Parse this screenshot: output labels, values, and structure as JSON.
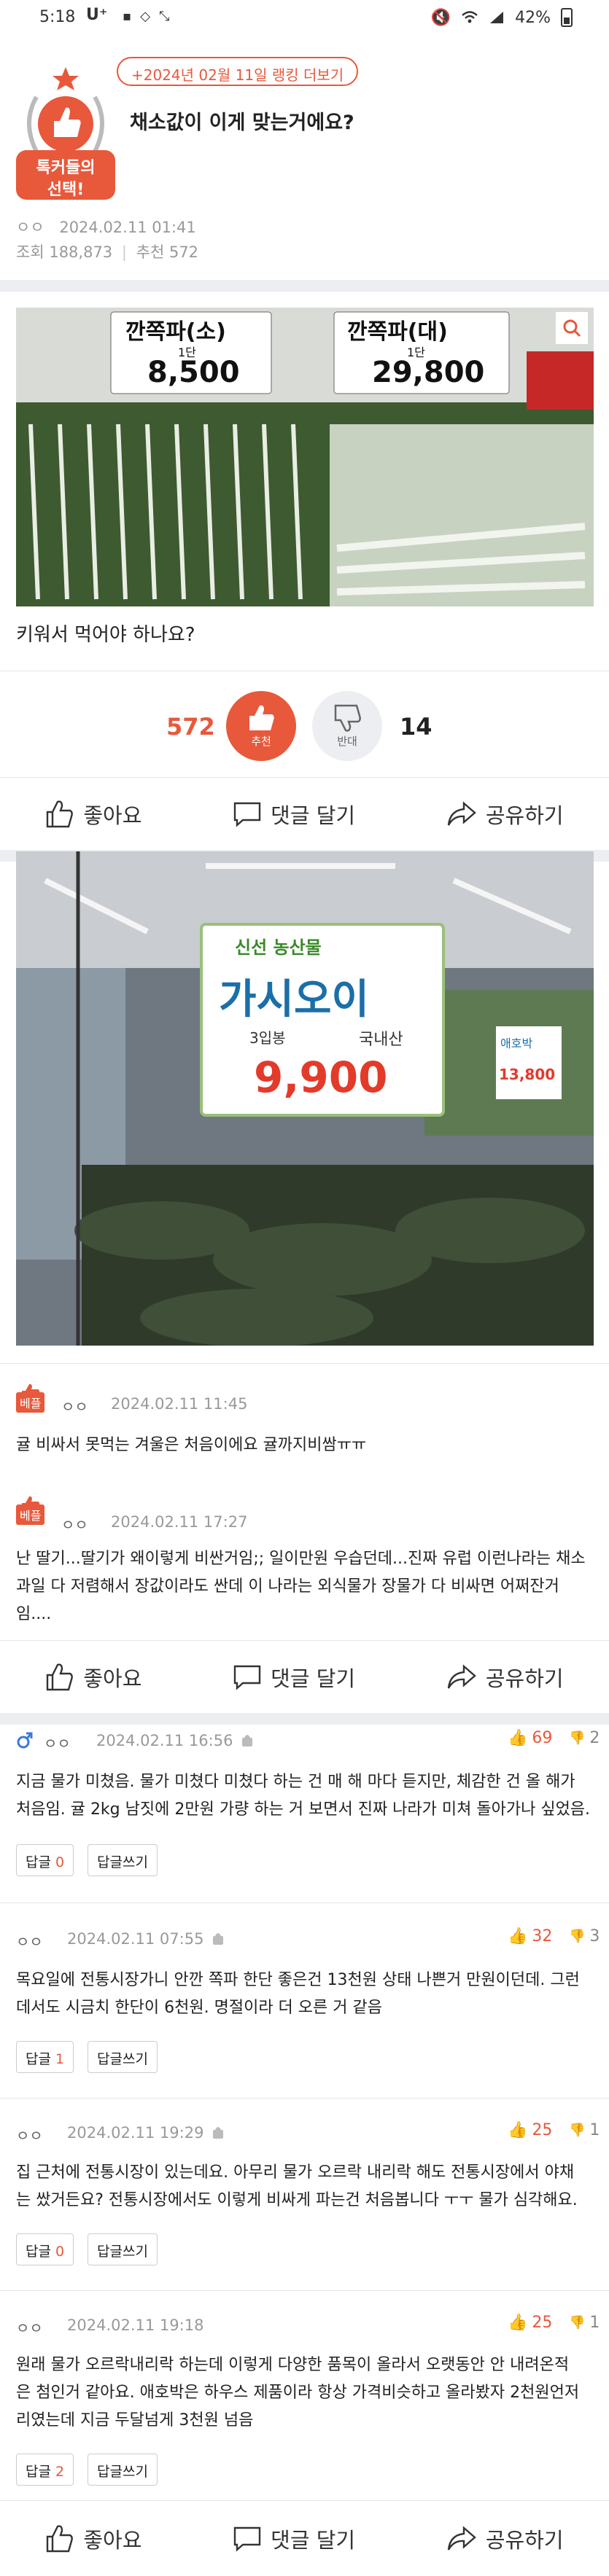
{
  "status_bar": {
    "time": "5:18",
    "carrier": "U⁺",
    "battery": "42%",
    "left_icons": [
      "talk-icon",
      "shield-icon",
      "expand-icon"
    ],
    "right_icons": [
      "mute-icon",
      "wifi-icon",
      "signal-icon"
    ]
  },
  "post": {
    "ranking_badge": "+2024년 02월 11일 랭킹 더보기",
    "mark_line1": "톡커들의",
    "mark_line2": "선택!",
    "title": "채소값이 이게 맞는거에요?",
    "author": "ㅇㅇ",
    "date": "2024.02.11 01:41",
    "views_label": "조회",
    "views": "188,873",
    "recommend_label": "추천",
    "recommend": "572",
    "photo1_labels": [
      "깐쪽파(소)",
      "1단",
      "8,500",
      "깐쪽파(대)",
      "1단",
      "29,800"
    ],
    "body": "키워서 먹어야 하나요?",
    "photo2_labels": [
      "신선 농산물",
      "가시오이",
      "3입봉",
      "국내산",
      "9,900",
      "애호박",
      "13,800"
    ]
  },
  "vote": {
    "up_count": "572",
    "up_label": "추천",
    "down_count": "14",
    "down_label": "반대"
  },
  "actions": {
    "like": "좋아요",
    "comment": "댓글 달기",
    "share": "공유하기"
  },
  "best_comments": [
    {
      "tag": "베플",
      "nick": "ㅇㅇ",
      "date": "2024.02.11 11:45",
      "text": "귤 비싸서 못먹는 겨울은 처음이에요 귤까지비쌈ㅠㅠ"
    },
    {
      "tag": "베플",
      "nick": "ㅇㅇ",
      "date": "2024.02.11 17:27",
      "text_line1": "난 딸기...딸기가 왜이렇게 비싼거임;; 일이만원 우습던데...진짜 유럽 이런나라는 채소",
      "text_line2": "과일 다 저렴해서 장값이라도 싼데 이 나라는 외식물가 장물가 다 비싸면 어쩌잔거",
      "text_line3": "임...."
    }
  ],
  "comments": [
    {
      "nick": "ㅇㅇ",
      "date": "2024.02.11 16:56",
      "likes": "69",
      "dislikes": "2",
      "line1": "지금 물가 미쳤음. 물가 미쳤다 미쳤다 하는 건 매 해 마다 듣지만, 체감한 건 올 해가",
      "line2": "처음임. 귤 2kg 남짓에 2만원 가량 하는 거 보면서 진짜 나라가 미쳐 돌아가나 싶었음.",
      "reply_label": "답글",
      "reply_count": "0",
      "write_label": "답글쓰기"
    },
    {
      "nick": "ㅇㅇ",
      "date": "2024.02.11 07:55",
      "likes": "32",
      "dislikes": "3",
      "line1": "목요일에 전통시장가니 안깐 쪽파 한단 좋은건 13천원 상태 나쁜거 만원이던데. 그런",
      "line2": "데서도 시금치 한단이 6천원. 명절이라 더 오른 거 같음",
      "reply_label": "답글",
      "reply_count": "1",
      "write_label": "답글쓰기"
    },
    {
      "nick": "ㅇㅇ",
      "date": "2024.02.11 19:29",
      "likes": "25",
      "dislikes": "1",
      "line1": "집 근처에 전통시장이 있는데요. 아무리 물가 오르락 내리락 해도 전통시장에서 야채",
      "line2": "는 쌌거든요? 전통시장에서도 이렇게 비싸게 파는건 처음봅니다 ㅜㅜ 물가 심각해요.",
      "reply_label": "답글",
      "reply_count": "0",
      "write_label": "답글쓰기"
    },
    {
      "nick": "ㅇㅇ",
      "date": "2024.02.11 19:18",
      "likes": "25",
      "dislikes": "1",
      "line1": "원래 물가 오르락내리락 하는데 이렇게 다양한 품목이 올라서 오랫동안 안 내려온적",
      "line2": "은 첨인거 같아요. 애호박은 하우스 제품이라 항상 가격비슷하고 올라봤자 2천원언저",
      "line3": "리였는데 지금 두달넘게 3천원 넘음",
      "reply_label": "답글",
      "reply_count": "2",
      "write_label": "답글쓰기"
    }
  ],
  "colors": {
    "accent": "#e8583b",
    "divider": "#eceef1"
  }
}
